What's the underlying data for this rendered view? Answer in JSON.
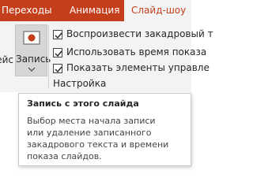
{
  "tabs": [
    {
      "label": "Переходы"
    },
    {
      "label": "Анимация"
    },
    {
      "label": "Слайд-шоу"
    }
  ],
  "ribbon": {
    "cut_label": "ейс",
    "record_button": {
      "label": "Запись"
    },
    "checkboxes": [
      {
        "label": "Воспроизвести закадровый т",
        "checked": true
      },
      {
        "label": "Использовать время показа",
        "checked": true
      },
      {
        "label": "Показать элементы управле",
        "checked": true
      }
    ],
    "group_label": "Настройка"
  },
  "tooltip": {
    "title": "Запись с этого слайда",
    "body": "Выбор места начала записи\nили удаление записанного\nзакадрового текста и времени\nпоказа слайдов."
  },
  "colors": {
    "accent": "#c43e1c",
    "ribbon_bg": "#f3f3f3",
    "record_red": "#c43e1c"
  }
}
